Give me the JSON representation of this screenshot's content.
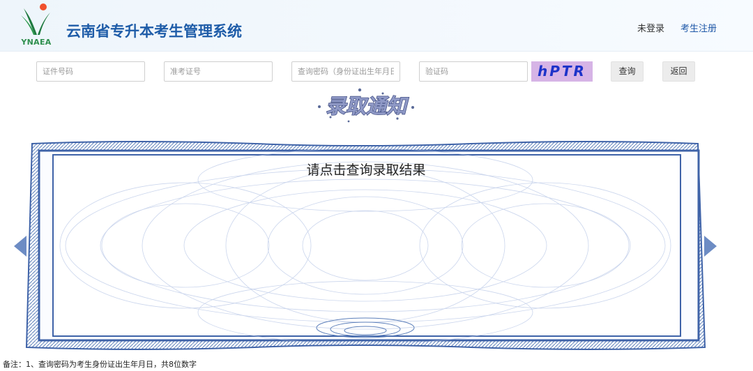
{
  "header": {
    "logo_text": "YNAEA",
    "title": "云南省专升本考生管理系统",
    "login_label": "未登录",
    "register_label": "考生注册"
  },
  "search": {
    "id_placeholder": "证件号码",
    "exam_no_placeholder": "准考证号",
    "password_placeholder": "查询密码（身份证出生年月日）",
    "captcha_placeholder": "验证码",
    "captcha_text": "hPTR",
    "query_label": "查询",
    "back_label": "返回"
  },
  "banner": {
    "text": "录取通知"
  },
  "certificate": {
    "message": "请点击查询录取结果"
  },
  "footnote": "备注：1、查询密码为考生身份证出生年月日，共8位数字",
  "colors": {
    "title_blue": "#1e5ca8",
    "frame_blue": "#3f63a8",
    "captcha_bg": "#d6b4e6",
    "captcha_text": "#1d33c9"
  }
}
